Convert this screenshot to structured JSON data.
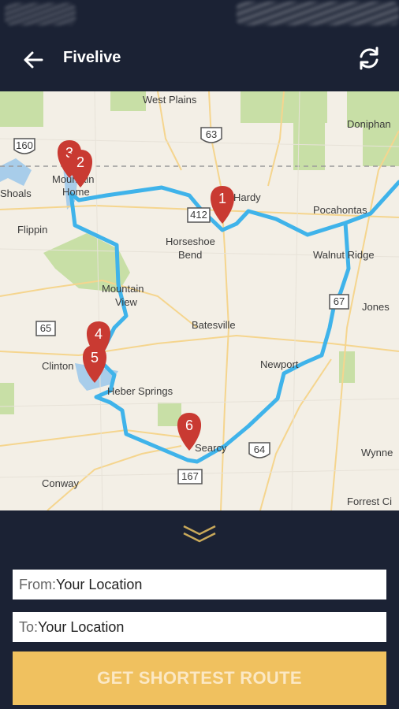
{
  "app_bar": {
    "title": "Fivelive",
    "back_icon": "arrow-left-icon",
    "refresh_icon": "refresh-icon"
  },
  "map": {
    "places": [
      "West Plains",
      "Doniphan",
      "Mountain",
      "Home",
      "Shoals",
      "Flippin",
      "Hardy",
      "Horseshoe",
      "Bend",
      "Pocahontas",
      "Walnut Ridge",
      "Mountain",
      "View",
      "Batesville",
      "Jones",
      "Clinton",
      "Heber Springs",
      "Newport",
      "Searcy",
      "Wynne",
      "Conway",
      "Forrest Ci"
    ],
    "highways": [
      "160",
      "63",
      "412",
      "67",
      "65",
      "64",
      "167"
    ],
    "markers": [
      "1",
      "2",
      "3",
      "4",
      "5",
      "6"
    ],
    "route_color": "#3fb3ea",
    "marker_color": "#c93a32"
  },
  "collapse_icon": "double-chevron-down-icon",
  "form": {
    "from_prefix": "From:",
    "from_value": "Your Location",
    "to_prefix": "To:",
    "to_value": "Your Location"
  },
  "action": {
    "label": "GET SHORTEST ROUTE",
    "color": "#f0c15f"
  }
}
